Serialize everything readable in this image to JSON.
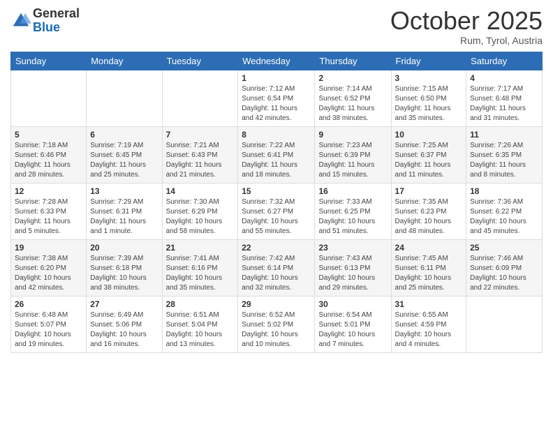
{
  "logo": {
    "general": "General",
    "blue": "Blue"
  },
  "header": {
    "month": "October 2025",
    "location": "Rum, Tyrol, Austria"
  },
  "weekdays": [
    "Sunday",
    "Monday",
    "Tuesday",
    "Wednesday",
    "Thursday",
    "Friday",
    "Saturday"
  ],
  "weeks": [
    [
      {
        "day": "",
        "info": ""
      },
      {
        "day": "",
        "info": ""
      },
      {
        "day": "",
        "info": ""
      },
      {
        "day": "1",
        "info": "Sunrise: 7:12 AM\nSunset: 6:54 PM\nDaylight: 11 hours and 42 minutes."
      },
      {
        "day": "2",
        "info": "Sunrise: 7:14 AM\nSunset: 6:52 PM\nDaylight: 11 hours and 38 minutes."
      },
      {
        "day": "3",
        "info": "Sunrise: 7:15 AM\nSunset: 6:50 PM\nDaylight: 11 hours and 35 minutes."
      },
      {
        "day": "4",
        "info": "Sunrise: 7:17 AM\nSunset: 6:48 PM\nDaylight: 11 hours and 31 minutes."
      }
    ],
    [
      {
        "day": "5",
        "info": "Sunrise: 7:18 AM\nSunset: 6:46 PM\nDaylight: 11 hours and 28 minutes."
      },
      {
        "day": "6",
        "info": "Sunrise: 7:19 AM\nSunset: 6:45 PM\nDaylight: 11 hours and 25 minutes."
      },
      {
        "day": "7",
        "info": "Sunrise: 7:21 AM\nSunset: 6:43 PM\nDaylight: 11 hours and 21 minutes."
      },
      {
        "day": "8",
        "info": "Sunrise: 7:22 AM\nSunset: 6:41 PM\nDaylight: 11 hours and 18 minutes."
      },
      {
        "day": "9",
        "info": "Sunrise: 7:23 AM\nSunset: 6:39 PM\nDaylight: 11 hours and 15 minutes."
      },
      {
        "day": "10",
        "info": "Sunrise: 7:25 AM\nSunset: 6:37 PM\nDaylight: 11 hours and 11 minutes."
      },
      {
        "day": "11",
        "info": "Sunrise: 7:26 AM\nSunset: 6:35 PM\nDaylight: 11 hours and 8 minutes."
      }
    ],
    [
      {
        "day": "12",
        "info": "Sunrise: 7:28 AM\nSunset: 6:33 PM\nDaylight: 11 hours and 5 minutes."
      },
      {
        "day": "13",
        "info": "Sunrise: 7:29 AM\nSunset: 6:31 PM\nDaylight: 11 hours and 1 minute."
      },
      {
        "day": "14",
        "info": "Sunrise: 7:30 AM\nSunset: 6:29 PM\nDaylight: 10 hours and 58 minutes."
      },
      {
        "day": "15",
        "info": "Sunrise: 7:32 AM\nSunset: 6:27 PM\nDaylight: 10 hours and 55 minutes."
      },
      {
        "day": "16",
        "info": "Sunrise: 7:33 AM\nSunset: 6:25 PM\nDaylight: 10 hours and 51 minutes."
      },
      {
        "day": "17",
        "info": "Sunrise: 7:35 AM\nSunset: 6:23 PM\nDaylight: 10 hours and 48 minutes."
      },
      {
        "day": "18",
        "info": "Sunrise: 7:36 AM\nSunset: 6:22 PM\nDaylight: 10 hours and 45 minutes."
      }
    ],
    [
      {
        "day": "19",
        "info": "Sunrise: 7:38 AM\nSunset: 6:20 PM\nDaylight: 10 hours and 42 minutes."
      },
      {
        "day": "20",
        "info": "Sunrise: 7:39 AM\nSunset: 6:18 PM\nDaylight: 10 hours and 38 minutes."
      },
      {
        "day": "21",
        "info": "Sunrise: 7:41 AM\nSunset: 6:16 PM\nDaylight: 10 hours and 35 minutes."
      },
      {
        "day": "22",
        "info": "Sunrise: 7:42 AM\nSunset: 6:14 PM\nDaylight: 10 hours and 32 minutes."
      },
      {
        "day": "23",
        "info": "Sunrise: 7:43 AM\nSunset: 6:13 PM\nDaylight: 10 hours and 29 minutes."
      },
      {
        "day": "24",
        "info": "Sunrise: 7:45 AM\nSunset: 6:11 PM\nDaylight: 10 hours and 25 minutes."
      },
      {
        "day": "25",
        "info": "Sunrise: 7:46 AM\nSunset: 6:09 PM\nDaylight: 10 hours and 22 minutes."
      }
    ],
    [
      {
        "day": "26",
        "info": "Sunrise: 6:48 AM\nSunset: 5:07 PM\nDaylight: 10 hours and 19 minutes."
      },
      {
        "day": "27",
        "info": "Sunrise: 6:49 AM\nSunset: 5:06 PM\nDaylight: 10 hours and 16 minutes."
      },
      {
        "day": "28",
        "info": "Sunrise: 6:51 AM\nSunset: 5:04 PM\nDaylight: 10 hours and 13 minutes."
      },
      {
        "day": "29",
        "info": "Sunrise: 6:52 AM\nSunset: 5:02 PM\nDaylight: 10 hours and 10 minutes."
      },
      {
        "day": "30",
        "info": "Sunrise: 6:54 AM\nSunset: 5:01 PM\nDaylight: 10 hours and 7 minutes."
      },
      {
        "day": "31",
        "info": "Sunrise: 6:55 AM\nSunset: 4:59 PM\nDaylight: 10 hours and 4 minutes."
      },
      {
        "day": "",
        "info": ""
      }
    ]
  ]
}
